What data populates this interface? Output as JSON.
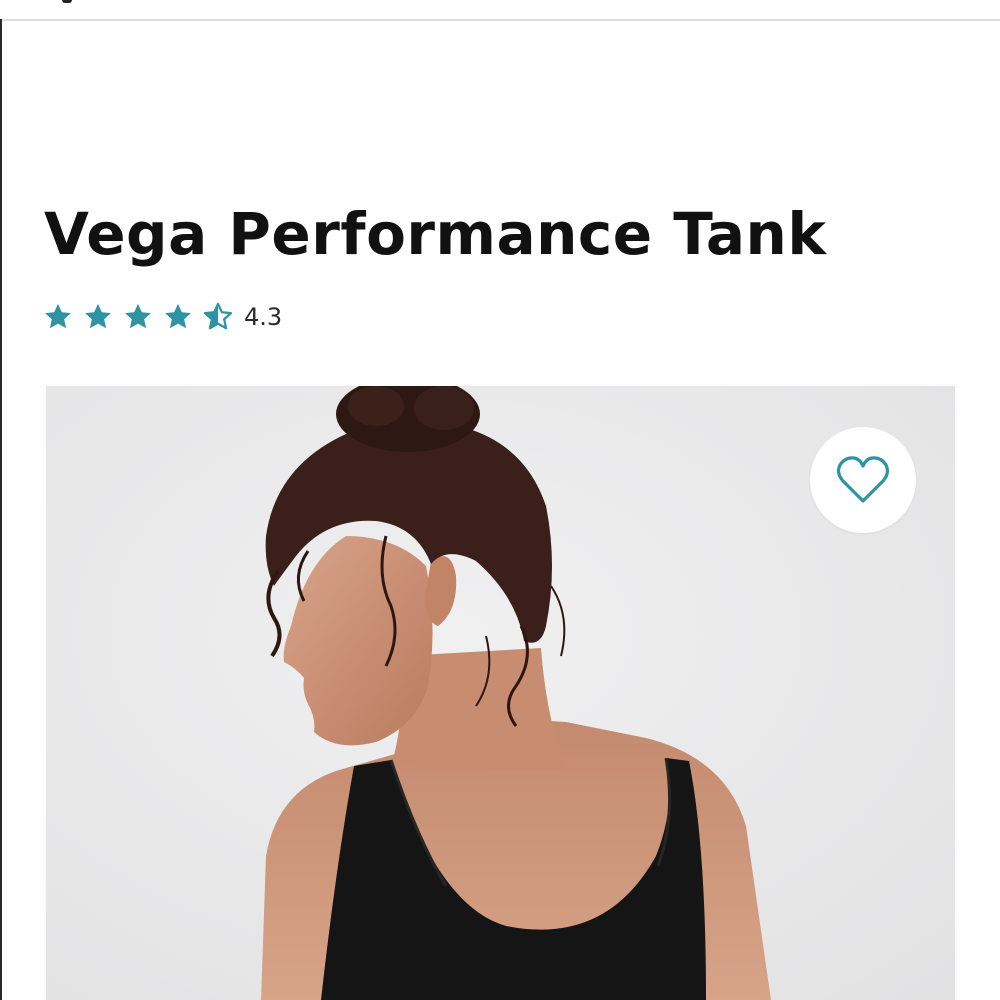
{
  "product": {
    "title": "Vega Performance Tank",
    "rating": {
      "value_label": "4.3",
      "value": 4.3,
      "max": 5,
      "full_stars": 4,
      "half_stars": 1
    },
    "image": {
      "alt": "Vega Performance Tank",
      "favorite_icon": "heart-outline-icon"
    }
  },
  "colors": {
    "accent": "#2e93a3",
    "title": "#111111",
    "image_background": "#e8e8e9",
    "tank": "#151515"
  },
  "icons": {
    "star_full": "star-filled-icon",
    "star_half": "star-half-icon",
    "favorite": "heart-icon"
  }
}
